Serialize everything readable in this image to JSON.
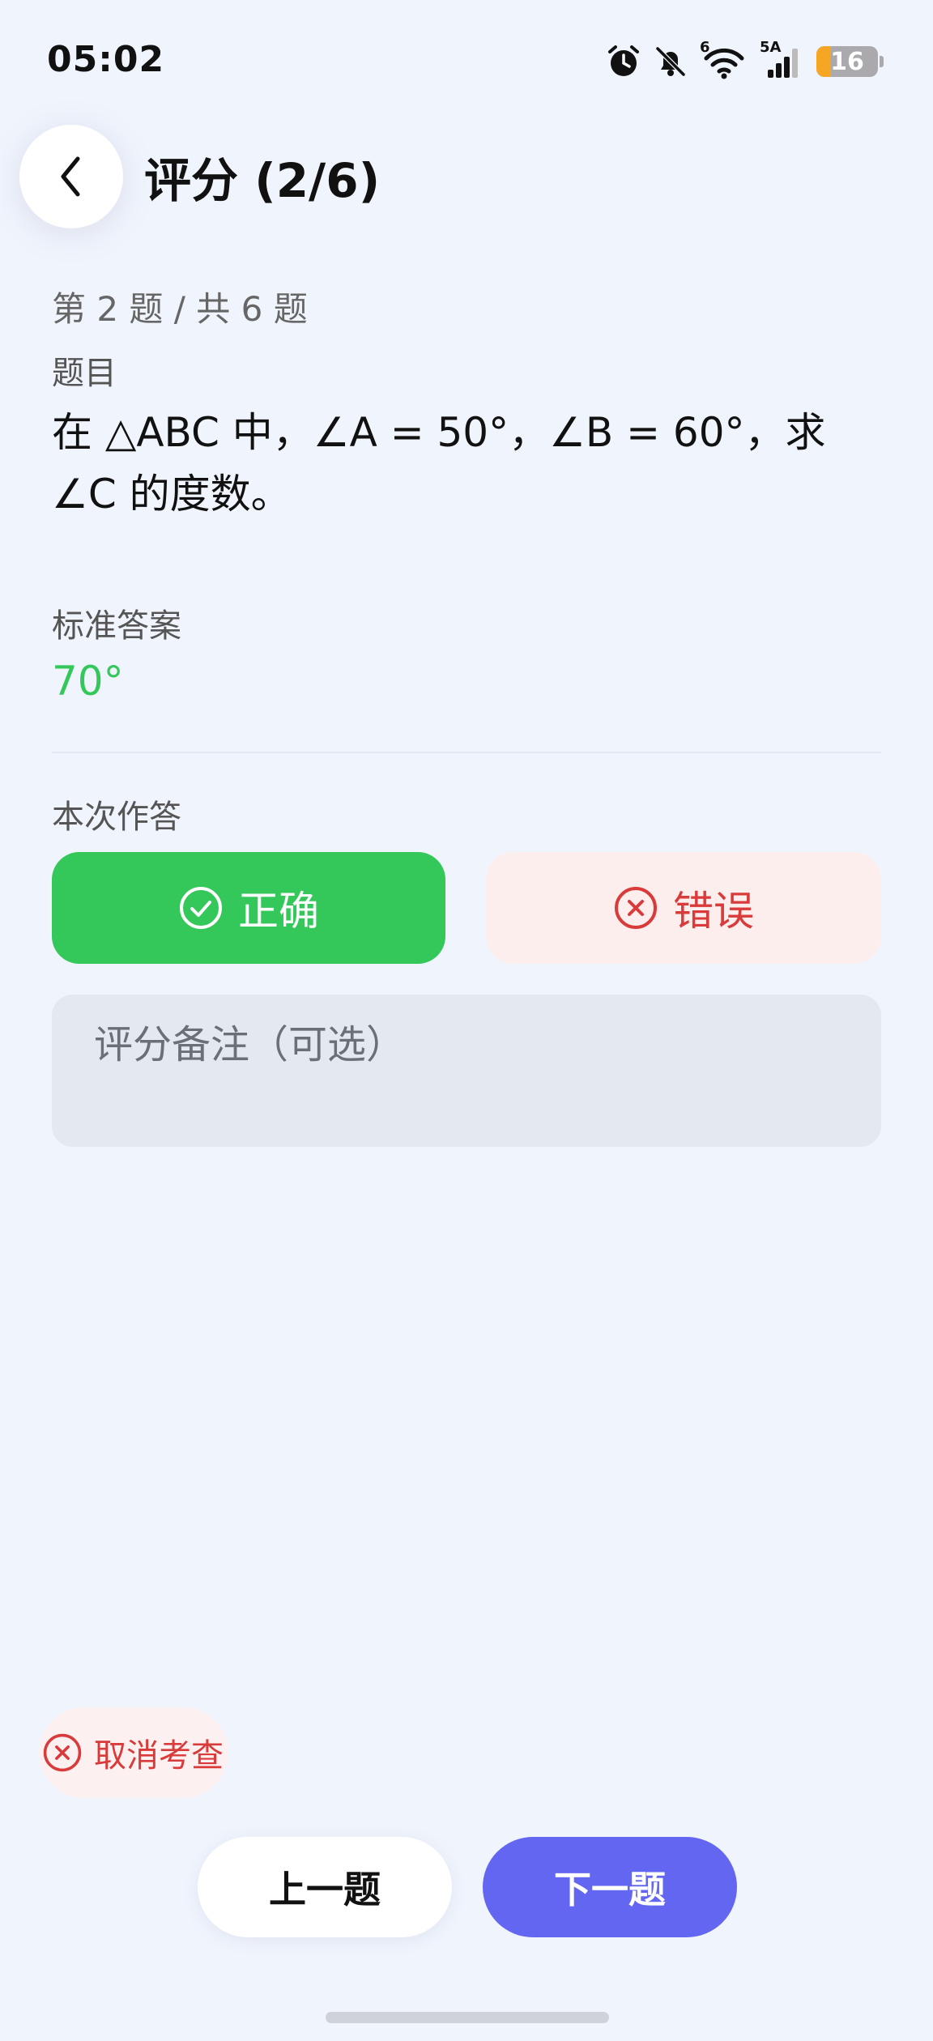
{
  "status_bar": {
    "time": "05:02",
    "icons": [
      "alarm-icon",
      "silent-bell-icon",
      "wifi-icon",
      "cellular-signal-icon",
      "battery-icon"
    ],
    "network_label": "5A",
    "wifi_label": "6",
    "battery_level": "16"
  },
  "header": {
    "back_icon": "chevron-left-icon",
    "title": "评分 (2/6)"
  },
  "question": {
    "progress": "第 2 题 / 共 6 题",
    "label": "题目",
    "text": "在 △ABC 中，∠A = 50°，∠B = 60°，求 ∠C 的度数。"
  },
  "standard_answer": {
    "label": "标准答案",
    "value": "70°"
  },
  "attempt": {
    "label": "本次作答",
    "correct_label": "正确",
    "wrong_label": "错误",
    "correct_icon": "check-circle-icon",
    "wrong_icon": "x-circle-icon"
  },
  "note": {
    "placeholder": "评分备注（可选）"
  },
  "footer": {
    "cancel_label": "取消考查",
    "prev_label": "上一题",
    "next_label": "下一题"
  },
  "colors": {
    "background": "#f0f4fc",
    "success": "#34c759",
    "danger": "#d93a3a",
    "primary": "#6366f1"
  }
}
